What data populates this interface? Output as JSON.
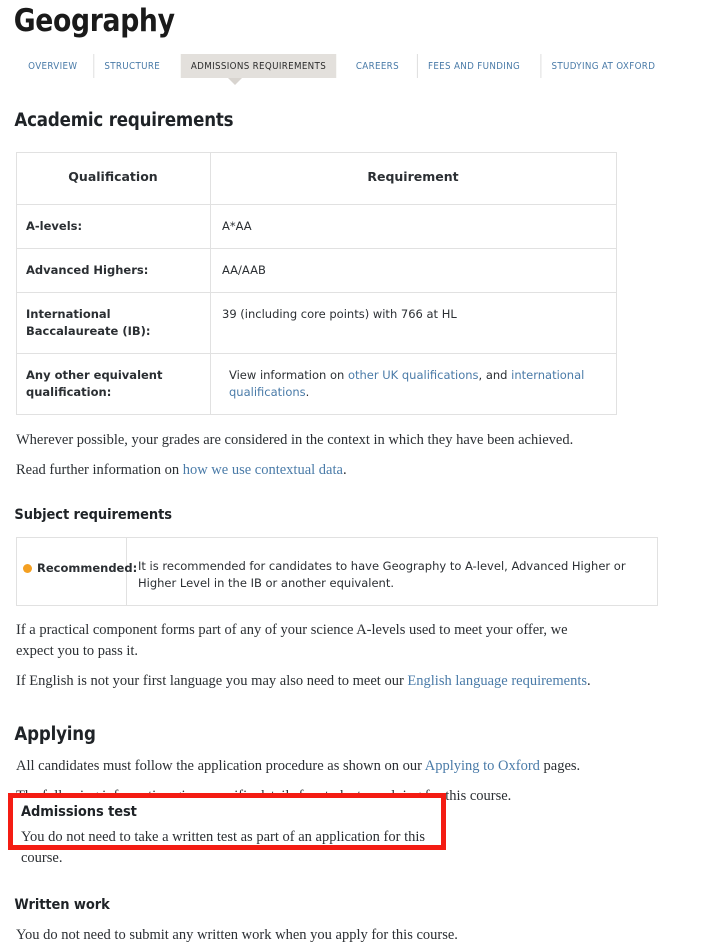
{
  "page": {
    "title": "Geography"
  },
  "tabs": [
    {
      "label": "OVERVIEW",
      "active": false
    },
    {
      "label": "STRUCTURE",
      "active": false
    },
    {
      "label": "ADMISSIONS REQUIREMENTS",
      "active": true
    },
    {
      "label": "CAREERS",
      "active": false
    },
    {
      "label": "FEES AND FUNDING",
      "active": false
    },
    {
      "label": "STUDYING AT OXFORD",
      "active": false
    }
  ],
  "academic": {
    "heading": "Academic requirements",
    "table": {
      "headers": [
        "Qualification",
        "Requirement"
      ],
      "rows": [
        {
          "qualification": "A-levels:",
          "requirement": "A*AA"
        },
        {
          "qualification": "Advanced Highers:",
          "requirement": "AA/AAB"
        },
        {
          "qualification": "International Baccalaureate (IB):",
          "requirement": "39 (including core points) with 766 at HL"
        },
        {
          "qualification": "Any other equivalent qualification:",
          "requirement_prefix": "View information on ",
          "requirement_link1": "other UK qualifications",
          "requirement_middle": ", and ",
          "requirement_link2": "international qualifications",
          "requirement_suffix": "."
        }
      ]
    },
    "note1": "Wherever possible, your grades are considered in the context in which they have been achieved.",
    "note2_prefix": "Read further information on ",
    "note2_link": "how we use contextual data",
    "note2_suffix": "."
  },
  "subject": {
    "heading": "Subject requirements",
    "label": "Recommended:",
    "text": "It is recommended for candidates to have Geography to A-level, Advanced Higher or Higher Level in the IB or another equivalent.",
    "note1": "If a practical component forms part of any of your science A-levels used to meet your offer, we expect you to pass it.",
    "note2_prefix": "If English is not your first language you may also need to meet our ",
    "note2_link": "English language requirements",
    "note2_suffix": "."
  },
  "applying": {
    "heading": "Applying",
    "para1_prefix": "All candidates must follow the application procedure as shown on our ",
    "para1_link": "Applying to Oxford",
    "para1_suffix": " pages.",
    "para2": "The following information gives specific details for students applying for this course."
  },
  "admissions_test": {
    "heading": "Admissions test",
    "text": "You do not need to take a written test as part of an application for this course."
  },
  "written_work": {
    "heading": "Written work",
    "text": "You do not need to submit any written work when you apply for this course."
  },
  "colors": {
    "link": "#4a7ba8",
    "highlight_border": "#f41c13",
    "recommended_dot": "#f4a022",
    "active_tab_bg": "#e3e0dc"
  }
}
